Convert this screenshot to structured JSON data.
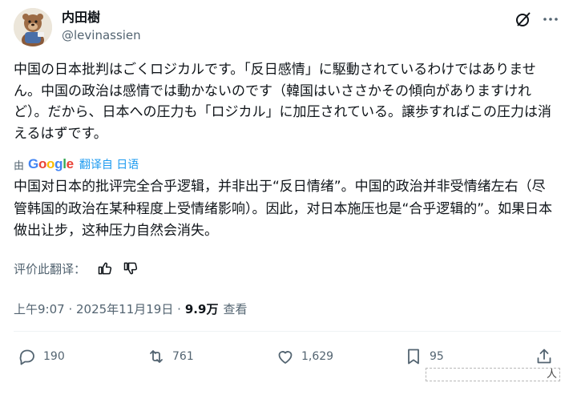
{
  "author": {
    "display_name": "内田樹",
    "handle": "@levinassien"
  },
  "post": {
    "original_text": "中国の日本批判はごくロジカルです。「反日感情」に駆動されているわけではありません。中国の政治は感情では動かないのです（韓国はいささかその傾向がありますけれど）。だから、日本への圧力も「ロジカル」に加圧されている。譲歩すればこの圧力は消えるはずです。",
    "translated_by_prefix": "由",
    "translator_brand": [
      "G",
      "o",
      "o",
      "g",
      "l",
      "e"
    ],
    "translated_from": "翻译自 日语",
    "translated_text": "中国对日本的批评完全合乎逻辑，并非出于“反日情绪”。中国的政治并非受情绪左右（尽管韩国的政治在某种程度上受情绪影响）。因此，对日本施压也是“合乎逻辑的”。如果日本做出让步，这种压力自然会消失。",
    "rate_translation_label": "评价此翻译："
  },
  "meta": {
    "timestamp": "上午9:07 · 2025年11月19日 · ",
    "views_count": "9.9万",
    "views_label": "查看"
  },
  "actions": {
    "replies": "190",
    "reposts": "761",
    "likes": "1,629",
    "bookmarks": "95"
  },
  "watermark": {
    "text": "人"
  },
  "colors": {
    "text_primary": "#0f1419",
    "text_secondary": "#536471",
    "link": "#1d9bf0",
    "divider": "#eff3f4"
  },
  "icons": {
    "grok": "grok-icon",
    "more": "more-icon",
    "thumbs_up": "thumbs-up-icon",
    "thumbs_down": "thumbs-down-icon",
    "reply": "reply-icon",
    "repost": "repost-icon",
    "like": "heart-icon",
    "bookmark": "bookmark-icon",
    "share": "share-icon"
  }
}
